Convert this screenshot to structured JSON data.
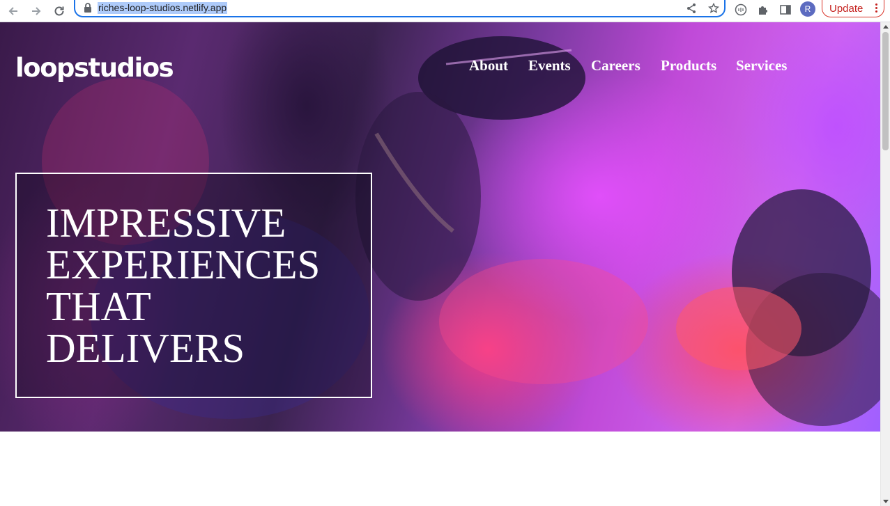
{
  "browser": {
    "url": "riches-loop-studios.netlify.app",
    "avatar_initial": "R",
    "update_label": "Update",
    "icons": [
      "back-arrow-icon",
      "forward-arrow-icon",
      "reload-icon",
      "lock-icon",
      "share-icon",
      "star-icon",
      "extension-icon",
      "puzzle-icon",
      "sidepanel-icon",
      "menu-dots-icon"
    ]
  },
  "site": {
    "logo": "loopstudios",
    "nav": [
      {
        "label": "About"
      },
      {
        "label": "Events"
      },
      {
        "label": "Careers"
      },
      {
        "label": "Products"
      },
      {
        "label": "Services"
      }
    ],
    "headline_lines": [
      "IMPRESSIVE",
      "EXPERIENCES",
      "THAT",
      "DELIVERS"
    ]
  },
  "colors": {
    "omnibox_focus": "#1a73e8",
    "url_selection": "#aecbfa",
    "update_red": "#d93025",
    "avatar": "#5c6bc0",
    "hero_text": "#ffffff"
  }
}
